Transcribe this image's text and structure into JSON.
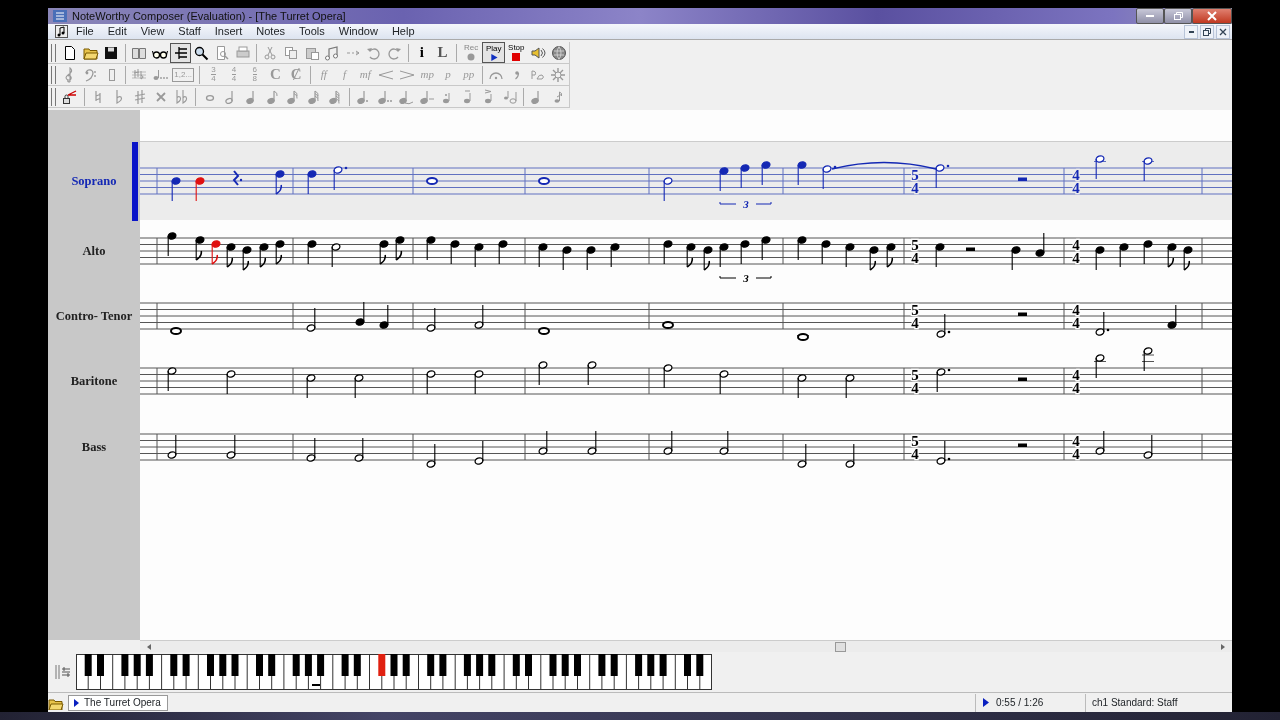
{
  "window": {
    "title": "NoteWorthy Composer (Evaluation) - [The Turret Opera]"
  },
  "menu": [
    "File",
    "Edit",
    "View",
    "Staff",
    "Insert",
    "Notes",
    "Tools",
    "Window",
    "Help"
  ],
  "main_toolbar": {
    "view_toggle_pressed": true,
    "info_label": "i",
    "layout_label": "L",
    "transport": [
      {
        "label": "Rec",
        "selected": false
      },
      {
        "label": "Play",
        "selected": true
      },
      {
        "label": "Stop",
        "selected": false
      }
    ]
  },
  "notation_toolbar": {
    "disabled": true,
    "sequence_label": "1,2...",
    "time_signatures": [
      {
        "numerator": "3",
        "denominator": "4"
      },
      {
        "numerator": "4",
        "denominator": "4"
      },
      {
        "numerator": "6",
        "denominator": "8"
      }
    ],
    "common_time": "C",
    "cut_time": "Ȼ",
    "dynamics_loud": [
      "ff",
      "f",
      "mf"
    ],
    "dynamics_soft": [
      "mp",
      "p",
      "pp"
    ]
  },
  "staves": [
    {
      "name": "Soprano",
      "selected": true,
      "time_signatures": [
        {
          "numerator": "5",
          "denominator": "4"
        },
        {
          "numerator": "4",
          "denominator": "4"
        }
      ],
      "tuplet_labels": [
        "3"
      ]
    },
    {
      "name": "Alto",
      "selected": false,
      "time_signatures": [
        {
          "numerator": "5",
          "denominator": "4"
        },
        {
          "numerator": "4",
          "denominator": "4"
        }
      ],
      "tuplet_labels": [
        "3"
      ]
    },
    {
      "name": "Contro- Tenor",
      "selected": false,
      "time_signatures": [
        {
          "numerator": "5",
          "denominator": "4"
        },
        {
          "numerator": "4",
          "denominator": "4"
        }
      ]
    },
    {
      "name": "Baritone",
      "selected": false,
      "time_signatures": [
        {
          "numerator": "5",
          "denominator": "4"
        },
        {
          "numerator": "4",
          "denominator": "4"
        }
      ]
    },
    {
      "name": "Bass",
      "selected": false,
      "time_signatures": [
        {
          "numerator": "5",
          "denominator": "4"
        },
        {
          "numerator": "4",
          "denominator": "4"
        }
      ]
    }
  ],
  "status_bar": {
    "file_tab": "The Turret Opera",
    "time": "0:55 / 1:26",
    "staff_info": "ch1 Standard: Staff"
  }
}
